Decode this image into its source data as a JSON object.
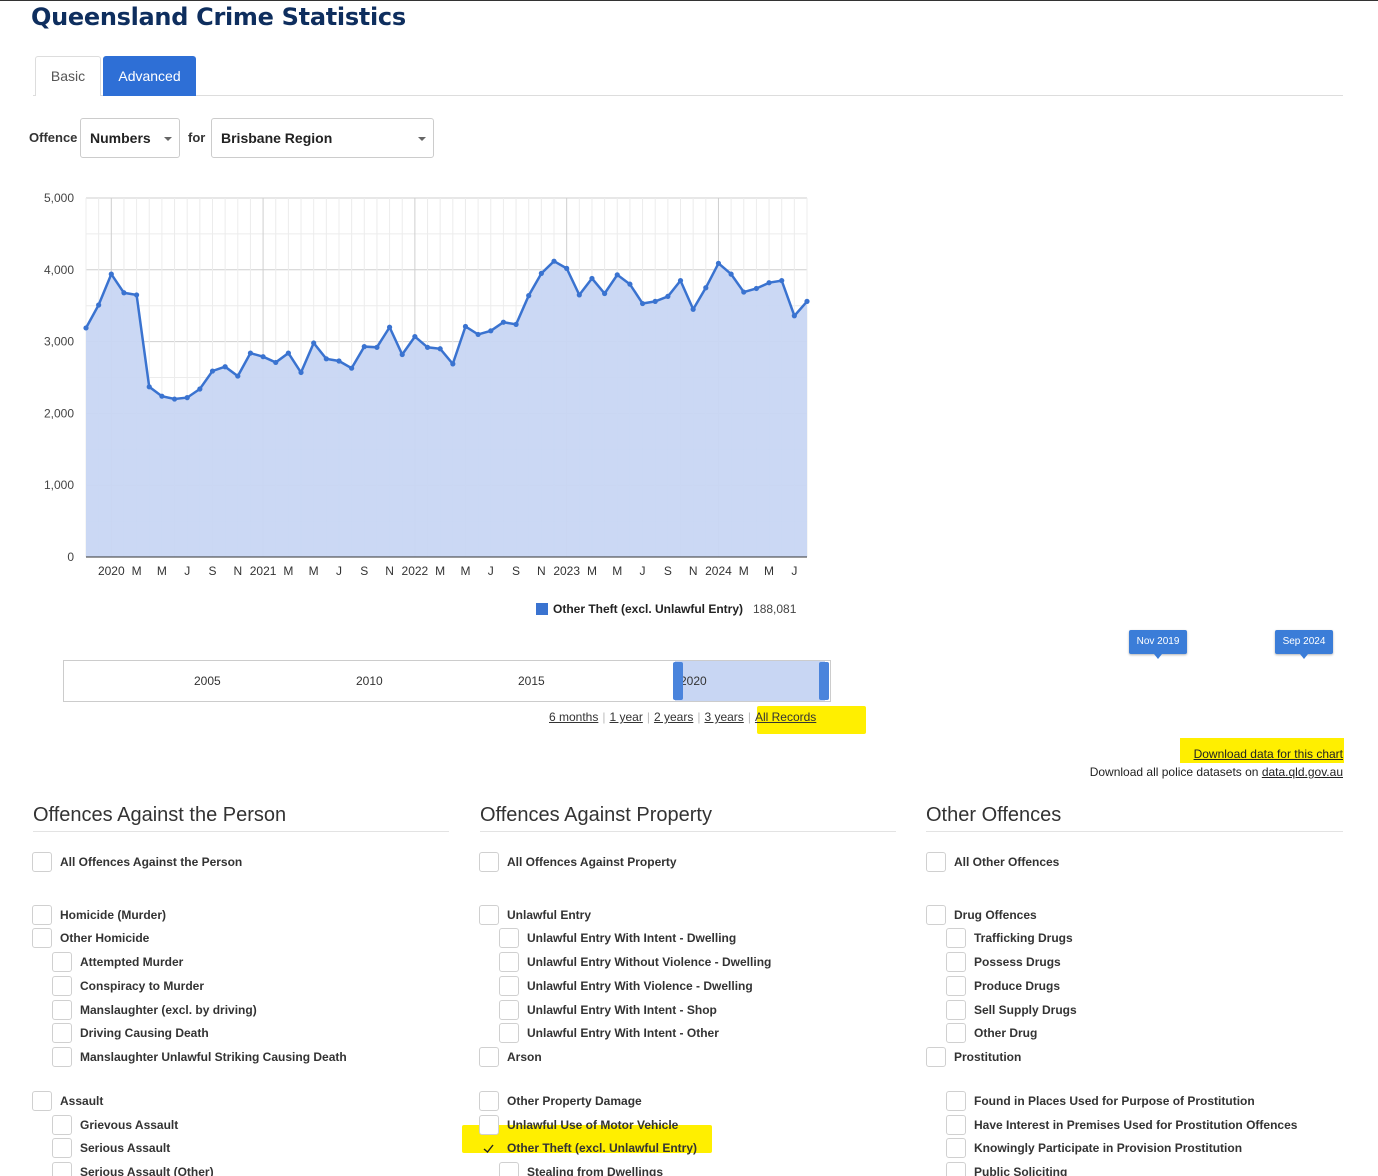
{
  "page": {
    "title": "Queensland Crime Statistics"
  },
  "tabs": {
    "basic": "Basic",
    "advanced": "Advanced"
  },
  "controls": {
    "offence_label": "Offence",
    "measure": "Numbers",
    "for_label": "for",
    "region": "Brisbane Region"
  },
  "chart_data": {
    "type": "area",
    "y_ticks": [
      "5,000",
      "4,000",
      "3,000",
      "2,000",
      "1,000",
      "0"
    ],
    "ylim": [
      0,
      5000
    ],
    "x_tick_labels": [
      "2020",
      "M",
      "M",
      "J",
      "S",
      "N",
      "2021",
      "M",
      "M",
      "J",
      "S",
      "N",
      "2022",
      "M",
      "M",
      "J",
      "S",
      "N",
      "2023",
      "M",
      "M",
      "J",
      "S",
      "N",
      "2024",
      "M",
      "M",
      "J"
    ],
    "grid": true,
    "series": [
      {
        "name": "Other Theft (excl. Unlawful Entry)",
        "total": "188,081",
        "color": "#3a73d0",
        "fill": "#c8d6f3",
        "x_start": "Nov 2019",
        "x_end": "Sep 2024",
        "values": [
          3190,
          3510,
          3940,
          3680,
          3650,
          2370,
          2240,
          2200,
          2220,
          2340,
          2590,
          2650,
          2520,
          2840,
          2790,
          2710,
          2840,
          2570,
          2980,
          2760,
          2730,
          2630,
          2930,
          2920,
          3200,
          2820,
          3070,
          2920,
          2900,
          2690,
          3210,
          3100,
          3150,
          3270,
          3240,
          3640,
          3950,
          4120,
          4020,
          3650,
          3880,
          3670,
          3930,
          3800,
          3530,
          3560,
          3630,
          3850,
          3450,
          3750,
          4090,
          3940,
          3690,
          3740,
          3820,
          3850,
          3360,
          3560
        ]
      }
    ],
    "legend_position": "bottom"
  },
  "range_selector": {
    "years": [
      "2005",
      "2010",
      "2015",
      "2020"
    ],
    "flag_start": "Nov 2019",
    "flag_end": "Sep 2024",
    "periods": [
      "6 months",
      "1 year",
      "2 years",
      "3 years",
      "All Records"
    ]
  },
  "downloads": {
    "chart": "Download data for this chart",
    "all_prefix": "Download all police datasets on ",
    "all_link": "data.qld.gov.au"
  },
  "person": {
    "heading": "Offences Against the Person",
    "all": "All Offences Against the Person",
    "items": [
      "Homicide (Murder)",
      "Other Homicide",
      "Attempted Murder",
      "Conspiracy to Murder",
      "Manslaughter (excl. by driving)",
      "Driving Causing Death",
      "Manslaughter Unlawful Striking Causing Death",
      "Assault",
      "Grievous Assault",
      "Serious Assault",
      "Serious Assault (Other)"
    ]
  },
  "property": {
    "heading": "Offences Against Property",
    "all": "All Offences Against Property",
    "items": [
      "Unlawful Entry",
      "Unlawful Entry With Intent - Dwelling",
      "Unlawful Entry Without Violence - Dwelling",
      "Unlawful Entry With Violence - Dwelling",
      "Unlawful Entry With Intent - Shop",
      "Unlawful Entry With Intent - Other",
      "Arson",
      "Other Property Damage",
      "Unlawful Use of Motor Vehicle",
      "Other Theft (excl. Unlawful Entry)",
      "Stealing from Dwellings"
    ],
    "checked": "Other Theft (excl. Unlawful Entry)"
  },
  "other": {
    "heading": "Other Offences",
    "all": "All Other Offences",
    "items": [
      "Drug Offences",
      "Trafficking Drugs",
      "Possess Drugs",
      "Produce Drugs",
      "Sell Supply Drugs",
      "Other Drug",
      "Prostitution",
      "Found in Places Used for Purpose of Prostitution",
      "Have Interest in Premises Used for Prostitution Offences",
      "Knowingly Participate in Provision Prostitution",
      "Public Soliciting"
    ]
  }
}
